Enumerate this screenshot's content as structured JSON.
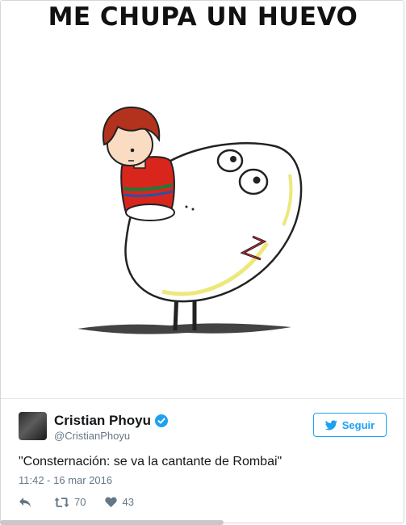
{
  "meme": {
    "caption": "ME CHUPA UN HUEVO"
  },
  "tweet": {
    "display_name": "Cristian Phoyu",
    "handle": "@CristianPhoyu",
    "verified": true,
    "follow_label": "Seguir",
    "text": "\"Consternación: se va la cantante de Rombai\"",
    "timestamp": "11:42 - 16 mar 2016",
    "retweets": "70",
    "likes": "43"
  },
  "icons": {
    "follow": "twitter-bird-icon",
    "verified": "verified-badge-icon",
    "reply": "reply-icon",
    "retweet": "retweet-icon",
    "like": "heart-icon"
  },
  "colors": {
    "accent": "#1da1f2",
    "muted": "#657786",
    "text": "#14171a"
  }
}
